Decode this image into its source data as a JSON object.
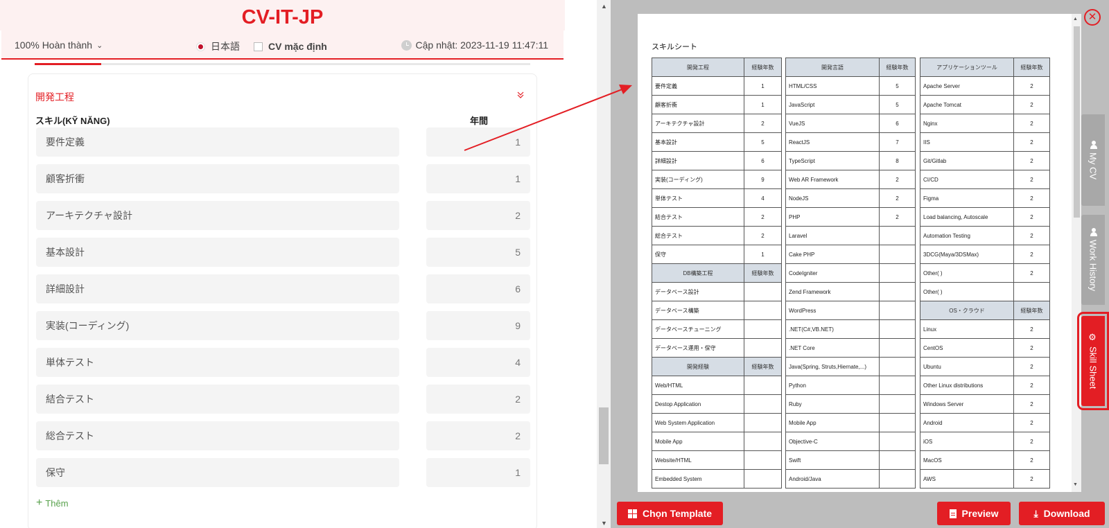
{
  "cv_title": "CV-IT-JP",
  "info_bar": {
    "progress": "100% Hoàn thành",
    "language": "日本語",
    "default_cv": "CV mặc định",
    "updated": "Cập nhật: 2023-11-19 11:47:11"
  },
  "section": {
    "title": "開発工程",
    "col_skill": "スキル(KỸ NĂNG)",
    "col_years": "年間",
    "rows": [
      {
        "name": "要件定義",
        "years": "1"
      },
      {
        "name": "顧客折衝",
        "years": "1"
      },
      {
        "name": "アーキテクチャ設計",
        "years": "2"
      },
      {
        "name": "基本設計",
        "years": "5"
      },
      {
        "name": "詳細設計",
        "years": "6"
      },
      {
        "name": "実装(コーディング)",
        "years": "9"
      },
      {
        "name": "単体テスト",
        "years": "4"
      },
      {
        "name": "結合テスト",
        "years": "2"
      },
      {
        "name": "総合テスト",
        "years": "2"
      },
      {
        "name": "保守",
        "years": "1"
      }
    ],
    "add_label": "Thêm"
  },
  "sheet": {
    "title": "スキルシート",
    "col1": [
      {
        "h": true,
        "a": "開発工程",
        "b": "経験年数"
      },
      {
        "a": "要件定義",
        "b": "1"
      },
      {
        "a": "顧客折衝",
        "b": "1"
      },
      {
        "a": "アーキテクチャ設計",
        "b": "2"
      },
      {
        "a": "基本設計",
        "b": "5"
      },
      {
        "a": "詳細設計",
        "b": "6"
      },
      {
        "a": "実装(コーディング)",
        "b": "9"
      },
      {
        "a": "単体テスト",
        "b": "4"
      },
      {
        "a": "結合テスト",
        "b": "2"
      },
      {
        "a": "総合テスト",
        "b": "2"
      },
      {
        "a": "保守",
        "b": "1"
      },
      {
        "h": true,
        "a": "DB構築工程",
        "b": "経験年数"
      },
      {
        "a": "データベース設計",
        "b": ""
      },
      {
        "a": "データベース構築",
        "b": ""
      },
      {
        "a": "データベースチューニング",
        "b": ""
      },
      {
        "a": "データベース運用・保守",
        "b": ""
      },
      {
        "h": true,
        "a": "開発経験",
        "b": "経験年数"
      },
      {
        "a": "Web/HTML",
        "b": ""
      },
      {
        "a": "Destop Application",
        "b": ""
      },
      {
        "a": "Web System Application",
        "b": ""
      },
      {
        "a": "Mobile App",
        "b": ""
      },
      {
        "a": "Website/HTML",
        "b": ""
      },
      {
        "a": "Embedded System",
        "b": ""
      }
    ],
    "col2": [
      {
        "h": true,
        "a": "開発言語",
        "b": "経験年数"
      },
      {
        "a": "HTML/CSS",
        "b": "5"
      },
      {
        "a": "JavaScript",
        "b": "5"
      },
      {
        "a": "VueJS",
        "b": "6"
      },
      {
        "a": "ReactJS",
        "b": "7"
      },
      {
        "a": "TypeScript",
        "b": "8"
      },
      {
        "a": "Web AR Framework",
        "b": "2"
      },
      {
        "a": "NodeJS",
        "b": "2"
      },
      {
        "a": "PHP",
        "b": "2"
      },
      {
        "a": "Laravel",
        "b": ""
      },
      {
        "a": "Cake PHP",
        "b": ""
      },
      {
        "a": "CodeIgniter",
        "b": ""
      },
      {
        "a": "Zend Framework",
        "b": ""
      },
      {
        "a": "WordPress",
        "b": ""
      },
      {
        "a": ".NET(C#,VB.NET)",
        "b": ""
      },
      {
        "a": ".NET Core",
        "b": ""
      },
      {
        "a": "Java(Spring, Struts,Hiernate,...)",
        "b": ""
      },
      {
        "a": "Python",
        "b": ""
      },
      {
        "a": "Ruby",
        "b": ""
      },
      {
        "a": "Mobile App",
        "b": ""
      },
      {
        "a": "Objective-C",
        "b": ""
      },
      {
        "a": "Swift",
        "b": ""
      },
      {
        "a": "Android/Java",
        "b": ""
      }
    ],
    "col3": [
      {
        "h": true,
        "a": "アプリケーションツール",
        "b": "経験年数"
      },
      {
        "a": "Apache Server",
        "b": "2"
      },
      {
        "a": "Apache Tomcat",
        "b": "2"
      },
      {
        "a": "Nginx",
        "b": "2"
      },
      {
        "a": "IIS",
        "b": "2"
      },
      {
        "a": "Git/Gitlab",
        "b": "2"
      },
      {
        "a": "CI/CD",
        "b": "2"
      },
      {
        "a": "Figma",
        "b": "2"
      },
      {
        "a": "Load balancing, Autoscale",
        "b": "2"
      },
      {
        "a": "Automation Testing",
        "b": "2"
      },
      {
        "a": "3DCG(Maya/3DSMax)",
        "b": "2"
      },
      {
        "a": "Other( )",
        "b": "2"
      },
      {
        "a": "Other( )",
        "b": ""
      },
      {
        "h": true,
        "a": "OS・クラウド",
        "b": "経験年数"
      },
      {
        "a": "Linux",
        "b": "2"
      },
      {
        "a": "CentOS",
        "b": "2"
      },
      {
        "a": "Ubuntu",
        "b": "2"
      },
      {
        "a": "Other Linux distributions",
        "b": "2"
      },
      {
        "a": "Windows Server",
        "b": "2"
      },
      {
        "a": "Android",
        "b": "2"
      },
      {
        "a": "iOS",
        "b": "2"
      },
      {
        "a": "MacOS",
        "b": "2"
      },
      {
        "a": "AWS",
        "b": "2"
      }
    ]
  },
  "side_tabs": {
    "my_cv": "My CV",
    "work_history": "Work History",
    "skill_sheet": "Skill Sheet"
  },
  "buttons": {
    "template": "Chọn Template",
    "preview": "Preview",
    "download": "Download"
  },
  "colors": {
    "accent": "#e31e24",
    "header_bg": "#fdf1f1",
    "table_header": "#d6dde5"
  }
}
